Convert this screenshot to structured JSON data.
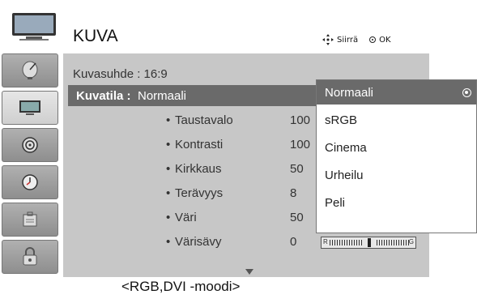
{
  "header": {
    "title": "KUVA",
    "move_hint": "Siirrä",
    "ok_hint": "OK"
  },
  "sidebar": {
    "items": [
      {
        "icon": "satellite-dish-icon",
        "active": false
      },
      {
        "icon": "tv-screen-icon",
        "active": true
      },
      {
        "icon": "speaker-icon",
        "active": false
      },
      {
        "icon": "clock-icon",
        "active": false
      },
      {
        "icon": "settings-box-icon",
        "active": false
      },
      {
        "icon": "lock-icon",
        "active": false
      }
    ]
  },
  "menu": {
    "aspect_ratio": "Kuvasuhde : 16:9",
    "picture_mode_label": "Kuvatila :",
    "picture_mode_value": "Normaali",
    "settings": [
      {
        "name": "Taustavalo",
        "value": "100"
      },
      {
        "name": "Kontrasti",
        "value": "100"
      },
      {
        "name": "Kirkkaus",
        "value": "50"
      },
      {
        "name": "Terävyys",
        "value": "8"
      },
      {
        "name": "Väri",
        "value": "50"
      },
      {
        "name": "Värisävy",
        "value": "0"
      }
    ],
    "tint_bar": {
      "left_label": "R",
      "right_label": "G",
      "position": 0.5
    }
  },
  "dropdown": {
    "options": [
      "Normaali",
      "sRGB",
      "Cinema",
      "Urheilu",
      "Peli"
    ],
    "selected": "Normaali"
  },
  "caption": "<RGB,DVI -moodi>"
}
